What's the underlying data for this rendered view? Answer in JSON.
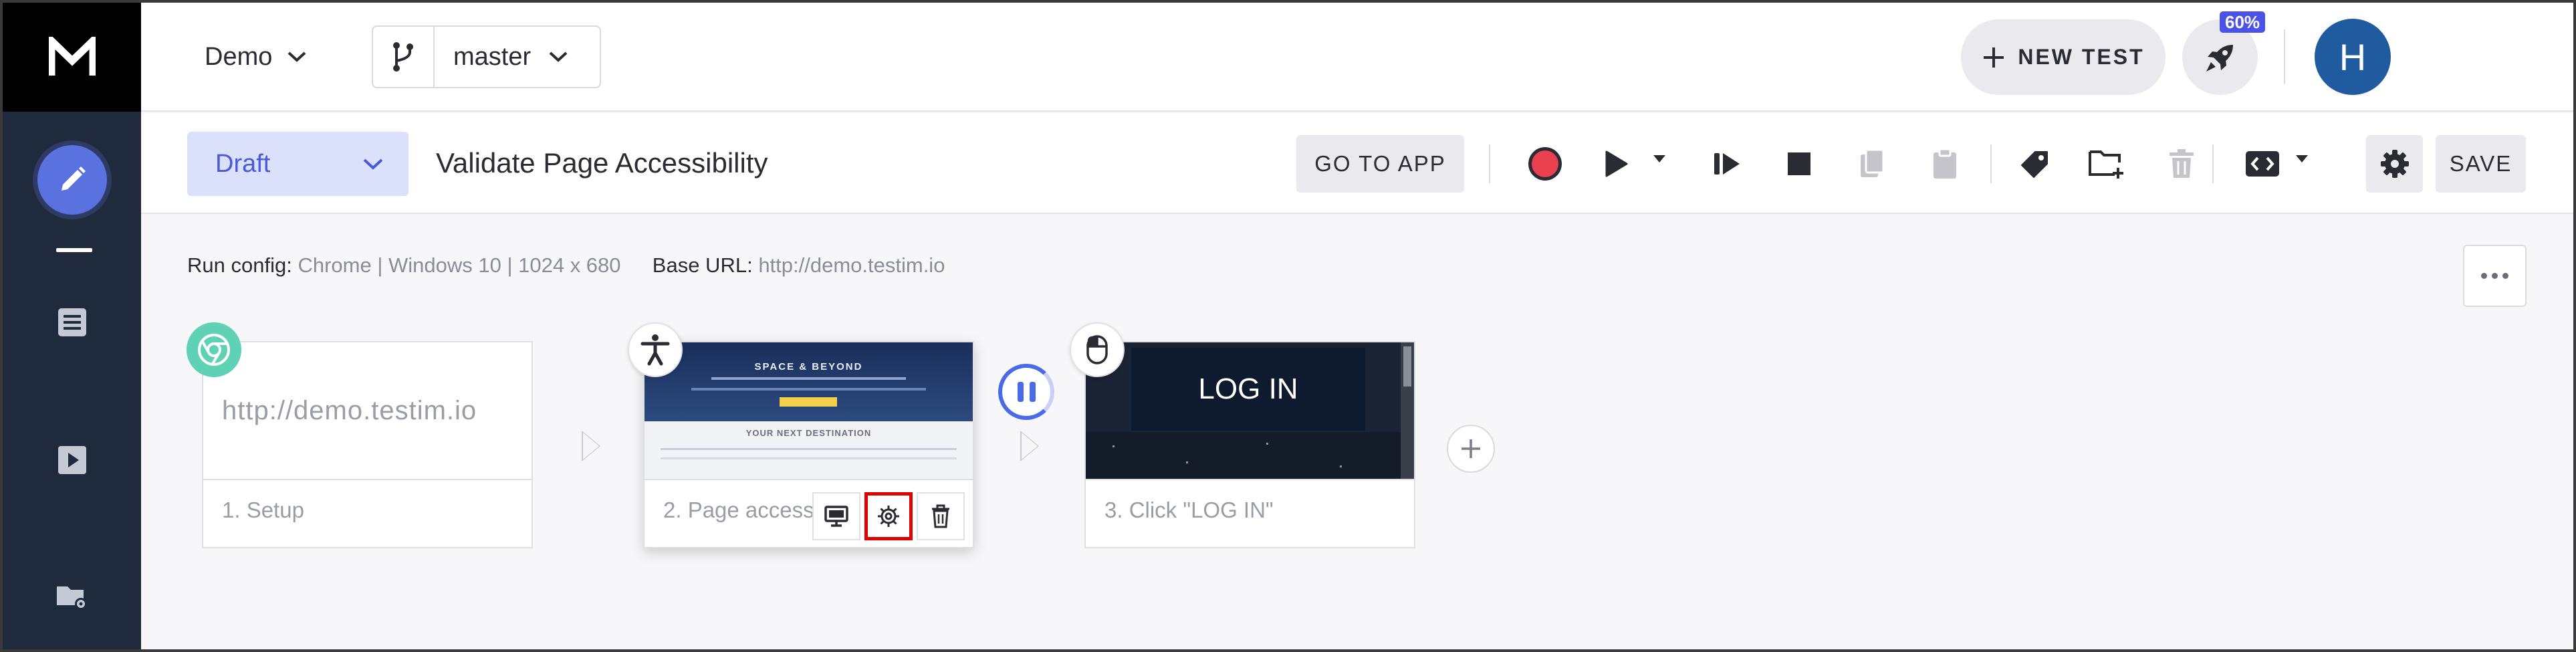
{
  "app": {
    "logo_letter": "M",
    "project": "Demo",
    "branch": "master"
  },
  "sidebar": {
    "items": [
      {
        "name": "editor",
        "icon": "pencil-icon",
        "active": true
      },
      {
        "name": "test-list",
        "icon": "list-icon"
      },
      {
        "name": "runs",
        "icon": "play-icon"
      },
      {
        "name": "settings",
        "icon": "folder-gear-icon"
      }
    ]
  },
  "header": {
    "new_test_label": "NEW TEST",
    "usage_badge": "60%",
    "avatar_initial": "H"
  },
  "toolbar": {
    "status": "Draft",
    "test_name": "Validate Page Accessibility",
    "go_to_app_label": "GO TO APP",
    "save_label": "SAVE",
    "accent_record": "#e8404f"
  },
  "canvas": {
    "run_config_label": "Run config:",
    "run_config_value": "Chrome | Windows 10 | 1024 x 680",
    "base_url_label": "Base URL:",
    "base_url_value": "http://demo.testim.io",
    "steps": [
      {
        "label": "1. Setup",
        "thumb_text": "http://demo.testim.io",
        "badge": "chrome-icon"
      },
      {
        "label": "2. Page accessibility",
        "badge": "accessibility-icon",
        "thumb_heading": "SPACE & BEYOND",
        "thumb_subheading": "YOUR NEXT DESTINATION"
      },
      {
        "label": "3. Click \"LOG IN\"",
        "thumb_text": "LOG IN",
        "badge": "mouse-icon"
      }
    ]
  },
  "colors": {
    "sidebar_bg": "#1f2a3d",
    "accent": "#4a6ae8",
    "draft_bg": "#dbe0fb",
    "highlight": "#e00000"
  }
}
